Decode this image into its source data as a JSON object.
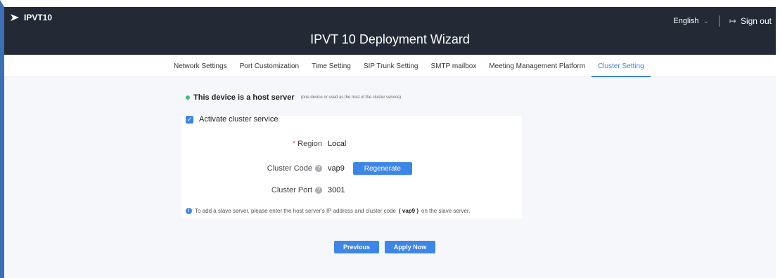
{
  "header": {
    "brand": "IPVT10",
    "wizard_title": "IPVT 10 Deployment Wizard",
    "language": "English",
    "sign_out": "Sign out"
  },
  "tabs": [
    {
      "label": "Network Settings",
      "active": false
    },
    {
      "label": "Port Customization",
      "active": false
    },
    {
      "label": "Time Setting",
      "active": false
    },
    {
      "label": "SIP Trunk Setting",
      "active": false
    },
    {
      "label": "SMTP mailbox",
      "active": false
    },
    {
      "label": "Meeting Management Platform",
      "active": false
    },
    {
      "label": "Cluster Setting",
      "active": true
    }
  ],
  "cluster": {
    "host_strong": "This device is a host server",
    "host_note": "(one device or used as the host of the cluster service)",
    "activate_label": "Activate cluster service",
    "activate_checked": true,
    "region_label": "Region",
    "region_value": "Local",
    "code_label": "Cluster Code",
    "code_value": "vap9",
    "regenerate": "Regenerate",
    "port_label": "Cluster Port",
    "port_value": "3001",
    "info_prefix": "To add a slave server, please enter the host server's IP address and cluster code",
    "info_code": "( vap9 )",
    "info_suffix": "on the slave server."
  },
  "footer": {
    "previous": "Previous",
    "apply": "Apply Now"
  },
  "colors": {
    "accent": "#3d86e8",
    "header_bg": "#232a36",
    "status_ok": "#3fbf6a"
  }
}
